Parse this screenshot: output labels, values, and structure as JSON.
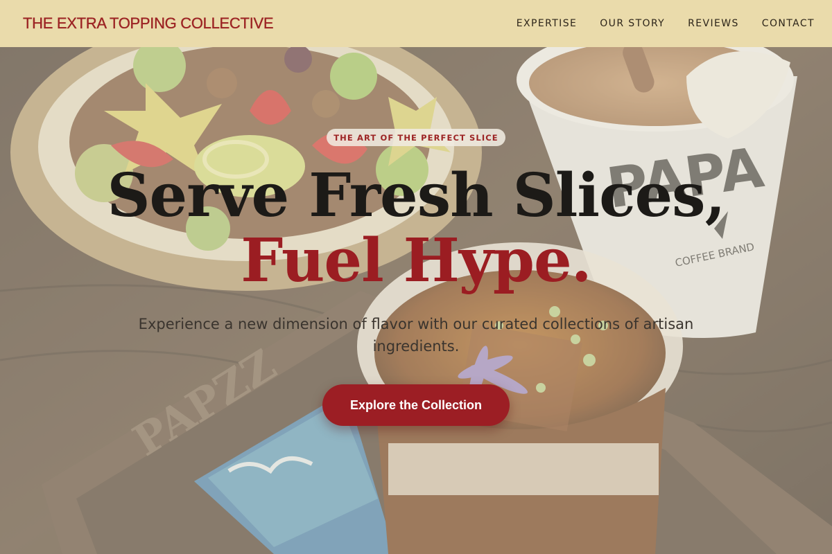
{
  "header": {
    "brand": "THE EXTRA TOPPING COLLECTIVE",
    "nav": [
      {
        "label": "EXPERTISE"
      },
      {
        "label": "OUR STORY"
      },
      {
        "label": "REVIEWS"
      },
      {
        "label": "CONTACT"
      }
    ]
  },
  "hero": {
    "badge": "THE ART OF THE PERFECT SLICE",
    "headline_line1": "Serve Fresh Slices,",
    "headline_line2": "Fuel Hype.",
    "subtitle": "Experience a new dimension of flavor with our curated collections of artisan ingredients.",
    "cta_label": "Explore the Collection"
  },
  "background": {
    "cup_brand": "PAPA",
    "cup_caption": "COFFEE BRAND",
    "tray_engraving": "PAPZZ"
  },
  "colors": {
    "brand_red": "#9c2424",
    "header_bg": "#eadbab",
    "cta_bg": "#9c1e24",
    "headline_dark": "#1c1a17"
  }
}
